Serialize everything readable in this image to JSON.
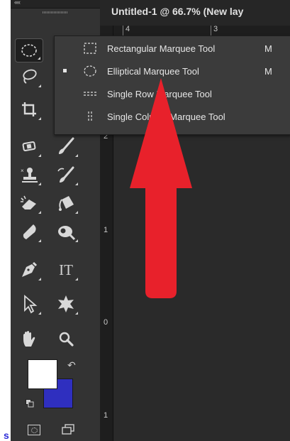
{
  "document": {
    "title": "Untitled-1 @ 66.7% (New lay",
    "hruler_labels": [
      "4",
      "3"
    ],
    "vruler_labels": [
      "2",
      "1",
      "0",
      "1"
    ]
  },
  "toolbar": {
    "collapse_label": "««",
    "tools": [
      {
        "name": "elliptical-marquee-tool",
        "icon": "ellipse-dotted-icon"
      },
      {
        "name": "lasso-tool",
        "icon": "lasso-icon"
      },
      {
        "name": "crop-tool",
        "icon": "crop-icon"
      },
      {
        "name": "spot-healing-tool",
        "icon": "bandage-icon"
      },
      {
        "name": "brush-tool",
        "icon": "brush-icon"
      },
      {
        "name": "clone-stamp-tool",
        "icon": "stamp-icon"
      },
      {
        "name": "history-brush-tool",
        "icon": "history-brush-icon"
      },
      {
        "name": "eraser-tool",
        "icon": "eraser-icon"
      },
      {
        "name": "paint-bucket-tool",
        "icon": "bucket-icon"
      },
      {
        "name": "blur-tool",
        "icon": "drop-icon"
      },
      {
        "name": "dodge-tool",
        "icon": "dodge-icon"
      },
      {
        "name": "pen-tool",
        "icon": "pen-icon"
      },
      {
        "name": "type-tool",
        "icon": "type-icon",
        "label": "IT"
      },
      {
        "name": "path-selection-tool",
        "icon": "arrow-pointer-icon"
      },
      {
        "name": "custom-shape-tool",
        "icon": "shape-icon"
      },
      {
        "name": "hand-tool",
        "icon": "hand-icon"
      },
      {
        "name": "zoom-tool",
        "icon": "magnifier-icon"
      }
    ],
    "foreground_color": "#ffffff",
    "background_color": "#2f2fbf"
  },
  "flyout": {
    "items": [
      {
        "label": "Rectangular Marquee Tool",
        "shortcut": "M",
        "selected": false,
        "icon": "rect-marquee-icon"
      },
      {
        "label": "Elliptical Marquee Tool",
        "shortcut": "M",
        "selected": true,
        "icon": "ellipse-marquee-icon"
      },
      {
        "label": "Single Row Marquee Tool",
        "shortcut": "",
        "selected": false,
        "icon": "row-marquee-icon"
      },
      {
        "label": "Single Column Marquee Tool",
        "shortcut": "",
        "selected": false,
        "icon": "column-marquee-icon"
      }
    ]
  },
  "annotation": {
    "arrow_color": "#e8212b"
  },
  "stray_text": "s"
}
